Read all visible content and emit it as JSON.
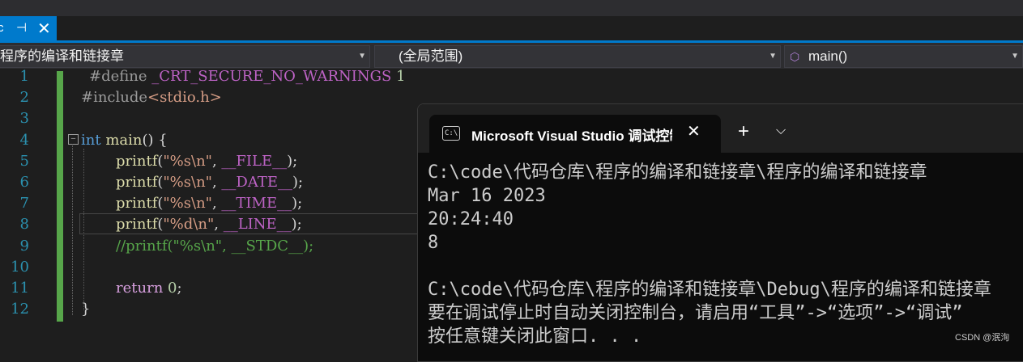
{
  "tab": {
    "title": "c",
    "pin": "⊣",
    "close": "✕"
  },
  "nav": {
    "project": "程序的编译和链接章",
    "scope": "(全局范围)",
    "member": "main()"
  },
  "editor": {
    "lines": [
      {
        "n": "1",
        "parts": [
          [
            "pp",
            "#define "
          ],
          [
            "mac",
            "_CRT_SECURE_NO_WARNINGS"
          ],
          [
            "num",
            " 1"
          ]
        ]
      },
      {
        "n": "2",
        "parts": [
          [
            "pp",
            "#include"
          ],
          [
            "str",
            "<stdio.h>"
          ]
        ]
      },
      {
        "n": "3",
        "parts": []
      },
      {
        "n": "4",
        "parts": [
          [
            "kw",
            "int"
          ],
          [
            "txt",
            " "
          ],
          [
            "fn",
            "main"
          ],
          [
            "txt",
            "() {"
          ]
        ]
      },
      {
        "n": "5",
        "parts": [
          [
            "fn",
            "printf"
          ],
          [
            "txt",
            "("
          ],
          [
            "str",
            "\"%s\\n\""
          ],
          [
            "txt",
            ", "
          ],
          [
            "mac",
            "__FILE__"
          ],
          [
            "txt",
            ");"
          ]
        ]
      },
      {
        "n": "6",
        "parts": [
          [
            "fn",
            "printf"
          ],
          [
            "txt",
            "("
          ],
          [
            "str",
            "\"%s\\n\""
          ],
          [
            "txt",
            ", "
          ],
          [
            "mac",
            "__DATE__"
          ],
          [
            "txt",
            ");"
          ]
        ]
      },
      {
        "n": "7",
        "parts": [
          [
            "fn",
            "printf"
          ],
          [
            "txt",
            "("
          ],
          [
            "str",
            "\"%s\\n\""
          ],
          [
            "txt",
            ", "
          ],
          [
            "mac",
            "__TIME__"
          ],
          [
            "txt",
            ");"
          ]
        ]
      },
      {
        "n": "8",
        "parts": [
          [
            "fn",
            "printf"
          ],
          [
            "txt",
            "("
          ],
          [
            "str",
            "\"%d\\n\""
          ],
          [
            "txt",
            ", "
          ],
          [
            "mac",
            "__LINE__"
          ],
          [
            "txt",
            ");"
          ]
        ]
      },
      {
        "n": "9",
        "parts": [
          [
            "cm",
            "//printf(\"%s\\n\", __STDC__);"
          ]
        ]
      },
      {
        "n": "10",
        "parts": []
      },
      {
        "n": "11",
        "parts": [
          [
            "ret",
            "return"
          ],
          [
            "txt",
            " "
          ],
          [
            "num",
            "0"
          ],
          [
            "txt",
            ";"
          ]
        ]
      },
      {
        "n": "12",
        "parts": [
          [
            "txt",
            "}"
          ]
        ]
      }
    ]
  },
  "console": {
    "title": "Microsoft Visual Studio 调试控制台",
    "icon_text": "C:\\",
    "close": "✕",
    "add": "+",
    "dropdown": "⌵",
    "output": [
      "C:\\code\\代码仓库\\程序的编译和链接章\\程序的编译和链接章",
      "Mar 16 2023",
      "20:24:40",
      "8",
      "",
      "C:\\code\\代码仓库\\程序的编译和链接章\\Debug\\程序的编译和链接章",
      "要在调试停止时自动关闭控制台，请启用“工具”->“选项”->“调试”",
      "按任意键关闭此窗口. . ."
    ]
  },
  "watermark": "CSDN @泯洵",
  "colors": {
    "accent": "#007acc",
    "gutter_changed": "#57a64a",
    "console_bg": "#0c0c0c"
  }
}
